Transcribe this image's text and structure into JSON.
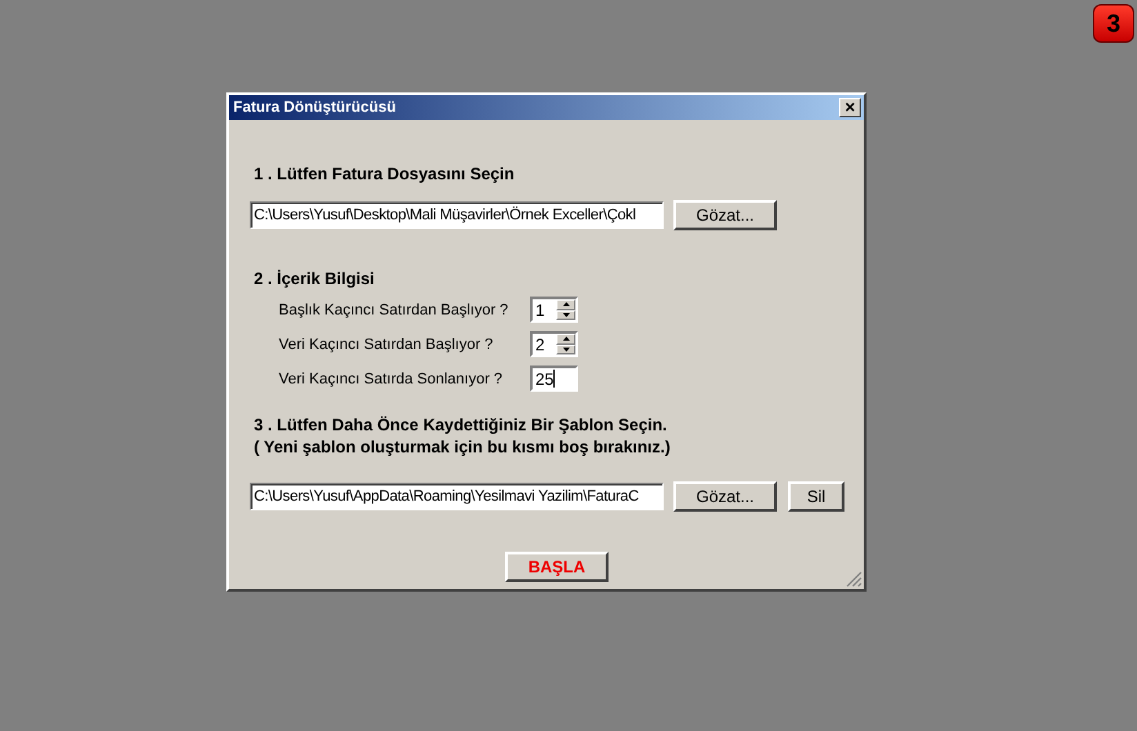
{
  "badge": "3",
  "window": {
    "title": "Fatura Dönüştürücüsü",
    "close": "×"
  },
  "section1": {
    "heading": "1 . Lütfen Fatura Dosyasını Seçin",
    "path": "C:\\Users\\Yusuf\\Desktop\\Mali Müşavirler\\Örnek Exceller\\Çokl",
    "browse": "Gözat..."
  },
  "section2": {
    "heading": "2 . İçerik Bilgisi",
    "rows": [
      {
        "label": "Başlık Kaçıncı Satırdan Başlıyor ?",
        "value": "1",
        "kind": "spinner",
        "focused": false
      },
      {
        "label": "Veri Kaçıncı Satırdan Başlıyor ?",
        "value": "2",
        "kind": "spinner",
        "focused": false
      },
      {
        "label": "Veri Kaçıncı Satırda Sonlanıyor ?",
        "value": "25",
        "kind": "text",
        "focused": true
      }
    ]
  },
  "section3": {
    "heading": "3 . Lütfen Daha Önce Kaydettiğiniz Bir Şablon Seçin.",
    "note": "( Yeni  şablon oluşturmak için bu kısmı boş bırakınız.)",
    "path": "C:\\Users\\Yusuf\\AppData\\Roaming\\Yesilmavi Yazilim\\FaturaC",
    "browse": "Gözat...",
    "delete": "Sil"
  },
  "start": "BAŞLA"
}
